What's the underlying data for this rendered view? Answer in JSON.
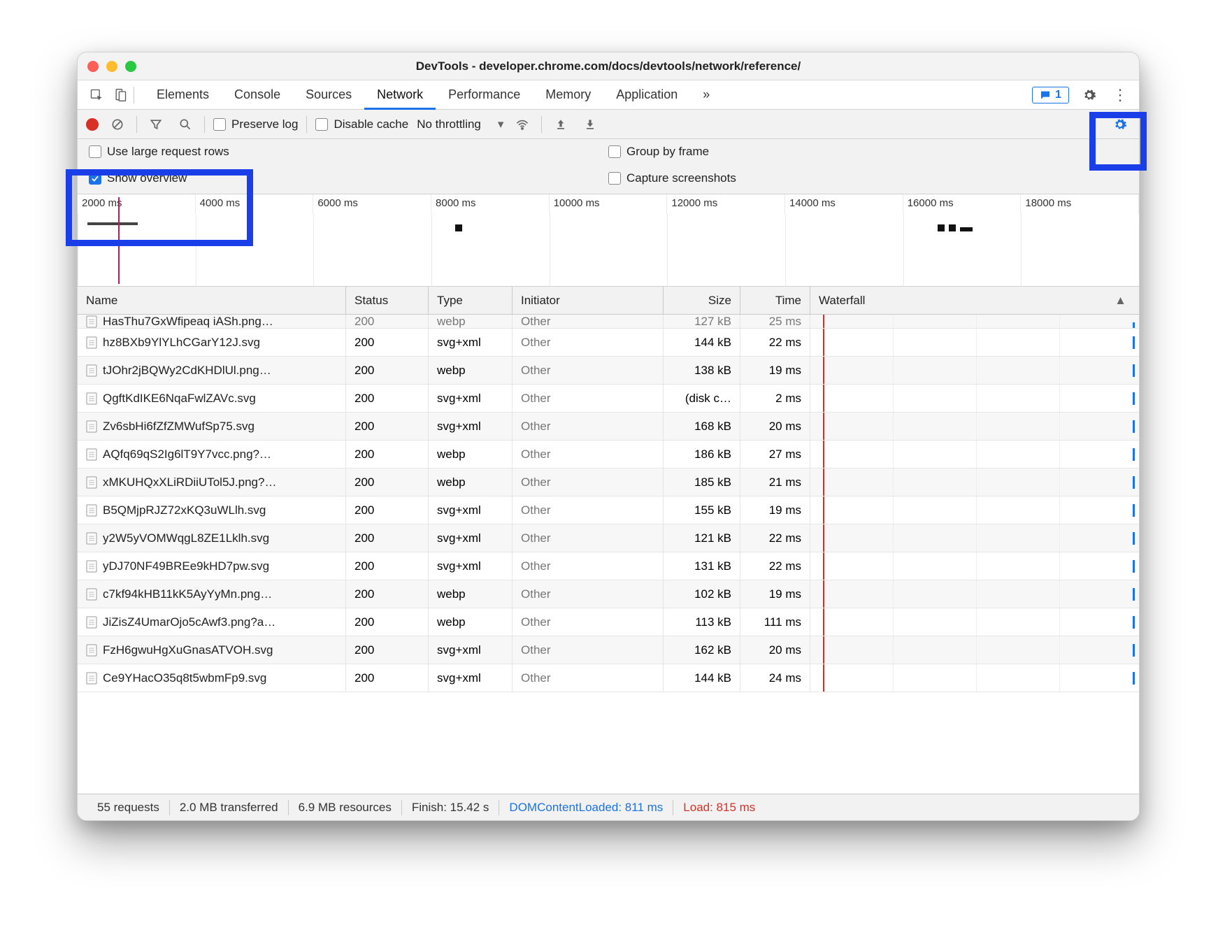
{
  "window": {
    "title": "DevTools - developer.chrome.com/docs/devtools/network/reference/"
  },
  "tabs": {
    "items": [
      "Elements",
      "Console",
      "Sources",
      "Network",
      "Performance",
      "Memory",
      "Application"
    ],
    "active_index": 3,
    "overflow": "»",
    "issues_count": "1"
  },
  "toolbar": {
    "preserve_log": "Preserve log",
    "disable_cache": "Disable cache",
    "throttling": "No throttling"
  },
  "settings": {
    "large_rows": "Use large request rows",
    "group_by_frame": "Group by frame",
    "show_overview": "Show overview",
    "capture_screenshots": "Capture screenshots"
  },
  "timeline": {
    "ticks": [
      "2000 ms",
      "4000 ms",
      "6000 ms",
      "8000 ms",
      "10000 ms",
      "12000 ms",
      "14000 ms",
      "16000 ms",
      "18000 ms"
    ]
  },
  "columns": {
    "name": "Name",
    "status": "Status",
    "type": "Type",
    "initiator": "Initiator",
    "size": "Size",
    "time": "Time",
    "waterfall": "Waterfall"
  },
  "cutoff_row": {
    "name": "HasThu7GxWfipeaq iASh.png…",
    "status": "200",
    "type": "webp",
    "initiator": "Other",
    "size": "127 kB",
    "time": "25 ms"
  },
  "rows": [
    {
      "name": "hz8BXb9YlYLhCGarY12J.svg",
      "status": "200",
      "type": "svg+xml",
      "initiator": "Other",
      "size": "144 kB",
      "time": "22 ms"
    },
    {
      "name": "tJOhr2jBQWy2CdKHDlUl.png…",
      "status": "200",
      "type": "webp",
      "initiator": "Other",
      "size": "138 kB",
      "time": "19 ms"
    },
    {
      "name": "QgftKdIKE6NqaFwlZAVc.svg",
      "status": "200",
      "type": "svg+xml",
      "initiator": "Other",
      "size": "(disk c…",
      "time": "2 ms"
    },
    {
      "name": "Zv6sbHi6fZfZMWufSp75.svg",
      "status": "200",
      "type": "svg+xml",
      "initiator": "Other",
      "size": "168 kB",
      "time": "20 ms"
    },
    {
      "name": "AQfq69qS2Ig6lT9Y7vcc.png?…",
      "status": "200",
      "type": "webp",
      "initiator": "Other",
      "size": "186 kB",
      "time": "27 ms"
    },
    {
      "name": "xMKUHQxXLiRDiiUTol5J.png?…",
      "status": "200",
      "type": "webp",
      "initiator": "Other",
      "size": "185 kB",
      "time": "21 ms"
    },
    {
      "name": "B5QMjpRJZ72xKQ3uWLlh.svg",
      "status": "200",
      "type": "svg+xml",
      "initiator": "Other",
      "size": "155 kB",
      "time": "19 ms"
    },
    {
      "name": "y2W5yVOMWqgL8ZE1Lklh.svg",
      "status": "200",
      "type": "svg+xml",
      "initiator": "Other",
      "size": "121 kB",
      "time": "22 ms"
    },
    {
      "name": "yDJ70NF49BREe9kHD7pw.svg",
      "status": "200",
      "type": "svg+xml",
      "initiator": "Other",
      "size": "131 kB",
      "time": "22 ms"
    },
    {
      "name": "c7kf94kHB11kK5AyYyMn.png…",
      "status": "200",
      "type": "webp",
      "initiator": "Other",
      "size": "102 kB",
      "time": "19 ms"
    },
    {
      "name": "JiZisZ4UmarOjo5cAwf3.png?a…",
      "status": "200",
      "type": "webp",
      "initiator": "Other",
      "size": "113 kB",
      "time": "111 ms"
    },
    {
      "name": "FzH6gwuHgXuGnasATVOH.svg",
      "status": "200",
      "type": "svg+xml",
      "initiator": "Other",
      "size": "162 kB",
      "time": "20 ms"
    },
    {
      "name": "Ce9YHacO35q8t5wbmFp9.svg",
      "status": "200",
      "type": "svg+xml",
      "initiator": "Other",
      "size": "144 kB",
      "time": "24 ms"
    }
  ],
  "statusbar": {
    "requests": "55 requests",
    "transferred": "2.0 MB transferred",
    "resources": "6.9 MB resources",
    "finish": "Finish: 15.42 s",
    "dcl": "DOMContentLoaded: 811 ms",
    "load": "Load: 815 ms"
  }
}
